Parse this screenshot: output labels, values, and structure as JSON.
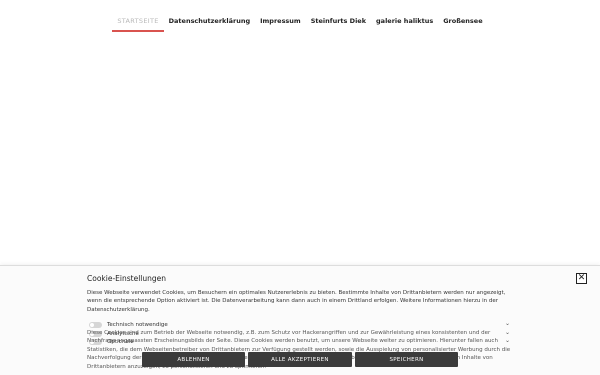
{
  "nav": {
    "items": [
      {
        "label": "STARTSEITE"
      },
      {
        "label": "Datenschutzerklärung"
      },
      {
        "label": "Impressum"
      },
      {
        "label": "Steinfurts Diek"
      },
      {
        "label": "galerie haliktus"
      },
      {
        "label": "Großensee"
      }
    ]
  },
  "cookie": {
    "title": "Cookie-Einstellungen",
    "close": "✕",
    "description": "Diese Webseite verwendet Cookies, um Besuchern ein optimales Nutzererlebnis zu bieten. Bestimmte Inhalte von Drittanbietern werden nur angezeigt, wenn die entsprechende Option aktiviert ist. Die Datenverarbeitung kann dann auch in einem Drittland erfolgen. Weitere Informationen hierzu in der Datenschutzerklärung.",
    "categories": [
      {
        "label": "Technisch notwendige"
      },
      {
        "label": "Analytische"
      },
      {
        "label": "Optionale"
      }
    ],
    "category_text": "Diese Cookies sind zum Betrieb der Webseite notwendig, z.B. zum Schutz vor Hackerangriffen und zur Gewährleistung eines konsistenten und der Nachfrage angepassten Erscheinungsbilds der Seite. Diese Cookies werden benutzt, um unsere Webseite weiter zu optimieren. Hierunter fallen auch Statistiken, die dem Webseitenbetreiber von Drittanbietern zur Verfügung gestellt werden, sowie die Ausspielung von personalisierter Werbung durch die Nachverfolgung der Nutzeraktivität über verschiedene Webseiten. Diese Cookies werden zum Abspielen von Videos verwendet und um Inhalte von Drittanbietern anzuzeigen, zu personalisieren und zu optimieren.",
    "buttons": {
      "decline": "ABLEHNEN",
      "accept_all": "ALLE AKZEPTIEREN",
      "save": "SPEICHERN"
    }
  }
}
